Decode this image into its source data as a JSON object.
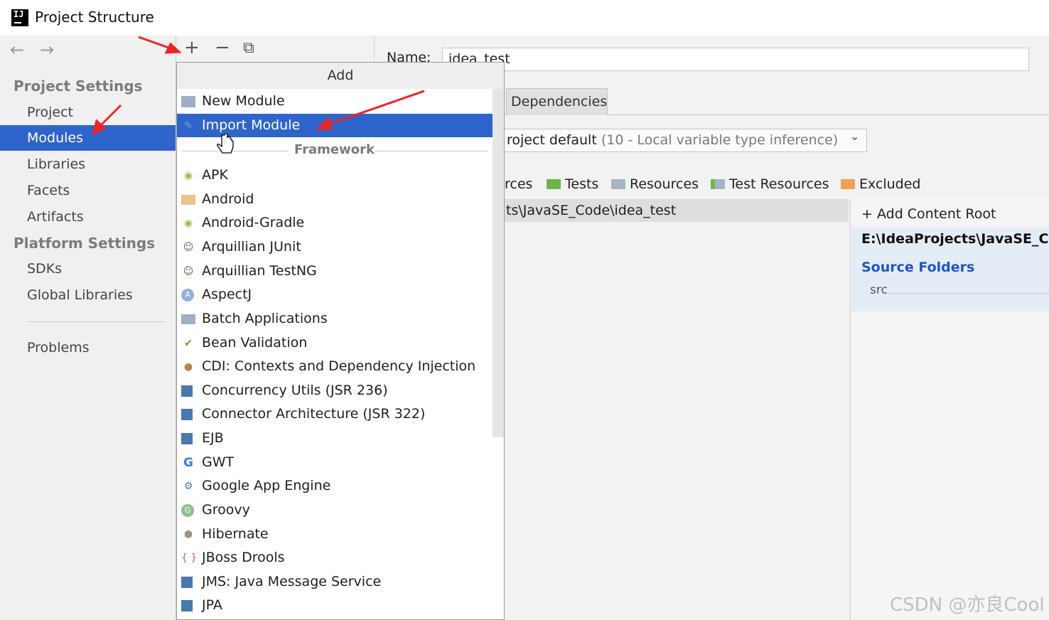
{
  "window": {
    "title": "Project Structure"
  },
  "nav": {
    "back": "←",
    "forward": "→"
  },
  "sidebar": {
    "project_settings_heading": "Project Settings",
    "project_items": [
      "Project",
      "Modules",
      "Libraries",
      "Facets",
      "Artifacts"
    ],
    "selected_item": "Modules",
    "platform_settings_heading": "Platform Settings",
    "platform_items": [
      "SDKs",
      "Global Libraries"
    ],
    "problems": "Problems"
  },
  "toolbar": {
    "add": "+",
    "remove": "−",
    "copy": "⧉"
  },
  "popup": {
    "title": "Add",
    "top_items": [
      {
        "label": "New Module",
        "icon": "module-folder-icon"
      },
      {
        "label": "Import Module",
        "icon": "import-module-icon",
        "selected": true
      }
    ],
    "framework_label": "Framework",
    "frameworks": [
      {
        "label": "APK",
        "icon": "android-robot-icon"
      },
      {
        "label": "Android",
        "icon": "android-folder-icon"
      },
      {
        "label": "Android-Gradle",
        "icon": "android-robot-icon"
      },
      {
        "label": "Arquillian JUnit",
        "icon": "arquillian-icon"
      },
      {
        "label": "Arquillian TestNG",
        "icon": "arquillian-icon"
      },
      {
        "label": "AspectJ",
        "icon": "aspectj-icon"
      },
      {
        "label": "Batch Applications",
        "icon": "batch-icon"
      },
      {
        "label": "Bean Validation",
        "icon": "bean-validation-icon"
      },
      {
        "label": "CDI: Contexts and Dependency Injection",
        "icon": "cdi-icon"
      },
      {
        "label": "Concurrency Utils (JSR 236)",
        "icon": "javaee-icon"
      },
      {
        "label": "Connector Architecture (JSR 322)",
        "icon": "javaee-icon"
      },
      {
        "label": "EJB",
        "icon": "javaee-icon"
      },
      {
        "label": "GWT",
        "icon": "google-icon"
      },
      {
        "label": "Google App Engine",
        "icon": "app-engine-icon"
      },
      {
        "label": "Groovy",
        "icon": "groovy-icon"
      },
      {
        "label": "Hibernate",
        "icon": "hibernate-icon"
      },
      {
        "label": "JBoss Drools",
        "icon": "drools-icon"
      },
      {
        "label": "JMS: Java Message Service",
        "icon": "javaee-icon"
      },
      {
        "label": "JPA",
        "icon": "javaee-icon"
      }
    ]
  },
  "module": {
    "name_label": "Name:",
    "name_value": "idea_test",
    "tab_dependencies": "Dependencies",
    "language_level": "roject default",
    "language_level_hint": "(10 - Local variable type inference)",
    "mark_as": {
      "sources": "rces",
      "tests": "Tests",
      "resources": "Resources",
      "test_resources": "Test Resources",
      "excluded": "Excluded"
    },
    "content_path": "ts\\JavaSE_Code\\idea_test",
    "add_content_root": "Add Content Root",
    "root_path": "E:\\IdeaProjects\\JavaSE_Cod",
    "source_folders_heading": "Source Folders",
    "source_folder": "src"
  },
  "watermark": "CSDN @亦良Cool",
  "colors": {
    "selection": "#2f65ca",
    "annotation_arrow": "#e8262a",
    "source_folders_heading": "#1f56c2",
    "tests_folder": "#6fb34c",
    "excluded_folder": "#f0a05a"
  }
}
